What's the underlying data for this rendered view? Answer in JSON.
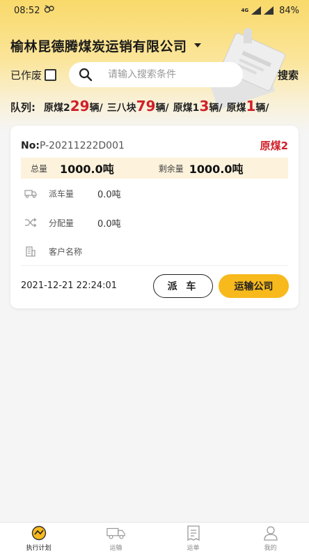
{
  "status_bar": {
    "time": "08:52",
    "network": "4G",
    "battery": "84%"
  },
  "header": {
    "company": "榆林昆德腾煤炭运销有限公司"
  },
  "filter": {
    "void_label": "已作废",
    "search_placeholder": "请输入搜索条件",
    "search_button": "搜索"
  },
  "queue": {
    "label": "队列:",
    "items": [
      {
        "name": "原煤2",
        "count": "29",
        "unit": "辆/"
      },
      {
        "name": "三八块",
        "count": "79",
        "unit": "辆/"
      },
      {
        "name": "原煤1",
        "count": "3",
        "unit": "辆/"
      },
      {
        "name": "原煤",
        "count": "1",
        "unit": "辆/"
      }
    ]
  },
  "order": {
    "no_label": "No:",
    "no_value": "P-20211222D001",
    "coal_type": "原煤2",
    "total_label": "总量",
    "total_value": "1000.0吨",
    "remaining_label": "剩余量",
    "remaining_value": "1000.0吨",
    "dispatched_label": "派车量",
    "dispatched_value": "0.0吨",
    "allocated_label": "分配量",
    "allocated_value": "0.0吨",
    "customer_label": "客户名称",
    "customer_value": "",
    "datetime": "2021-12-21 22:24:01",
    "dispatch_button": "派 车",
    "transport_button": "运输公司"
  },
  "tabs": [
    {
      "label": "执行计划",
      "icon": "plan-icon",
      "active": true
    },
    {
      "label": "运输",
      "icon": "truck-icon",
      "active": false
    },
    {
      "label": "运单",
      "icon": "waybill-icon",
      "active": false
    },
    {
      "label": "我的",
      "icon": "profile-icon",
      "active": false
    }
  ],
  "colors": {
    "accent": "#f7b91c",
    "highlight": "#d0202a",
    "header_bg": "#f9d96a"
  }
}
